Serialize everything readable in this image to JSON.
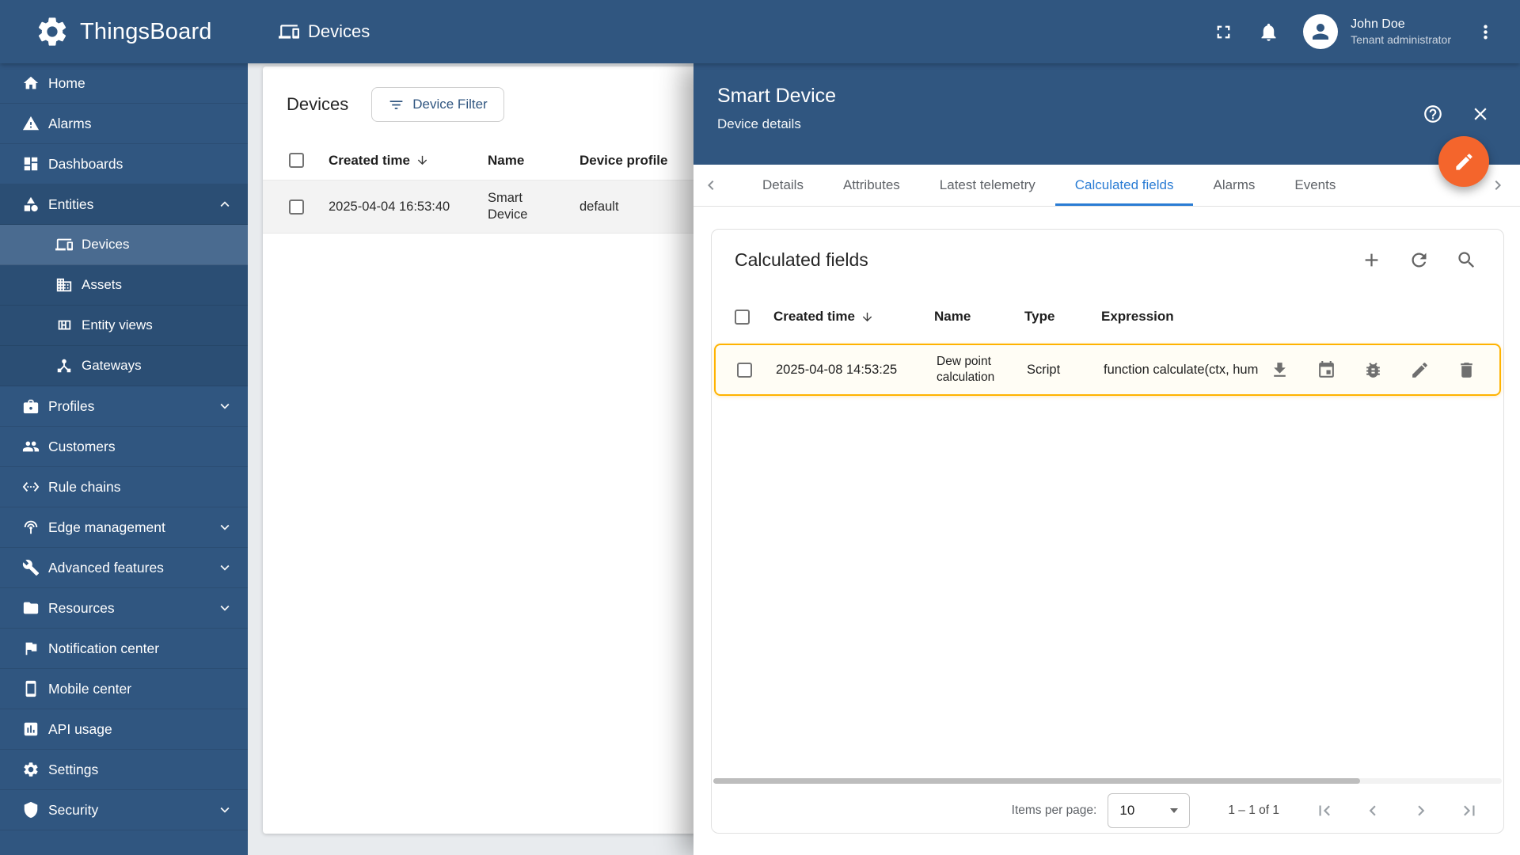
{
  "colors": {
    "primary": "#305680",
    "accent_tab": "#2a7cd4",
    "fab_orange": "#F4652C",
    "row_highlight_border": "#FFB300",
    "row_highlight_bg": "#FFFDF5"
  },
  "topbar": {
    "brand": "ThingsBoard",
    "page_title": "Devices",
    "user": {
      "name": "John Doe",
      "role": "Tenant administrator"
    }
  },
  "sidebar": {
    "items": [
      {
        "label": "Home",
        "icon": "home"
      },
      {
        "label": "Alarms",
        "icon": "warning"
      },
      {
        "label": "Dashboards",
        "icon": "dashboard"
      },
      {
        "label": "Entities",
        "icon": "category",
        "expandable": true,
        "expanded": true,
        "children": [
          {
            "label": "Devices",
            "icon": "devices",
            "active": true
          },
          {
            "label": "Assets",
            "icon": "assets"
          },
          {
            "label": "Entity views",
            "icon": "entity-views"
          },
          {
            "label": "Gateways",
            "icon": "gateway"
          }
        ]
      },
      {
        "label": "Profiles",
        "icon": "profiles",
        "expandable": true
      },
      {
        "label": "Customers",
        "icon": "customers"
      },
      {
        "label": "Rule chains",
        "icon": "rule-chains"
      },
      {
        "label": "Edge management",
        "icon": "edge",
        "expandable": true
      },
      {
        "label": "Advanced features",
        "icon": "advanced",
        "expandable": true
      },
      {
        "label": "Resources",
        "icon": "resources",
        "expandable": true
      },
      {
        "label": "Notification center",
        "icon": "notification"
      },
      {
        "label": "Mobile center",
        "icon": "mobile"
      },
      {
        "label": "API usage",
        "icon": "api"
      },
      {
        "label": "Settings",
        "icon": "settings"
      },
      {
        "label": "Security",
        "icon": "security",
        "expandable": true
      }
    ]
  },
  "devices_panel": {
    "title": "Devices",
    "filter_button": "Device Filter",
    "columns": [
      "Created time",
      "Name",
      "Device profile"
    ],
    "rows": [
      {
        "created_time": "2025-04-04 16:53:40",
        "name": "Smart Device",
        "profile": "default"
      }
    ]
  },
  "details_panel": {
    "title": "Smart Device",
    "subtitle": "Device details",
    "tabs": [
      "Details",
      "Attributes",
      "Latest telemetry",
      "Calculated fields",
      "Alarms",
      "Events"
    ],
    "active_tab": "Calculated fields",
    "calculated_fields": {
      "title": "Calculated fields",
      "columns": [
        "Created time",
        "Name",
        "Type",
        "Expression"
      ],
      "rows": [
        {
          "created_time": "2025-04-08 14:53:25",
          "name": "Dew point calculation",
          "type": "Script",
          "expression": "function calculate(ctx, hum"
        }
      ],
      "row_actions": [
        "download",
        "debug-settings",
        "debug",
        "edit",
        "delete"
      ],
      "pagination": {
        "items_per_page_label": "Items per page:",
        "items_per_page": "10",
        "range": "1 – 1 of 1"
      }
    }
  }
}
